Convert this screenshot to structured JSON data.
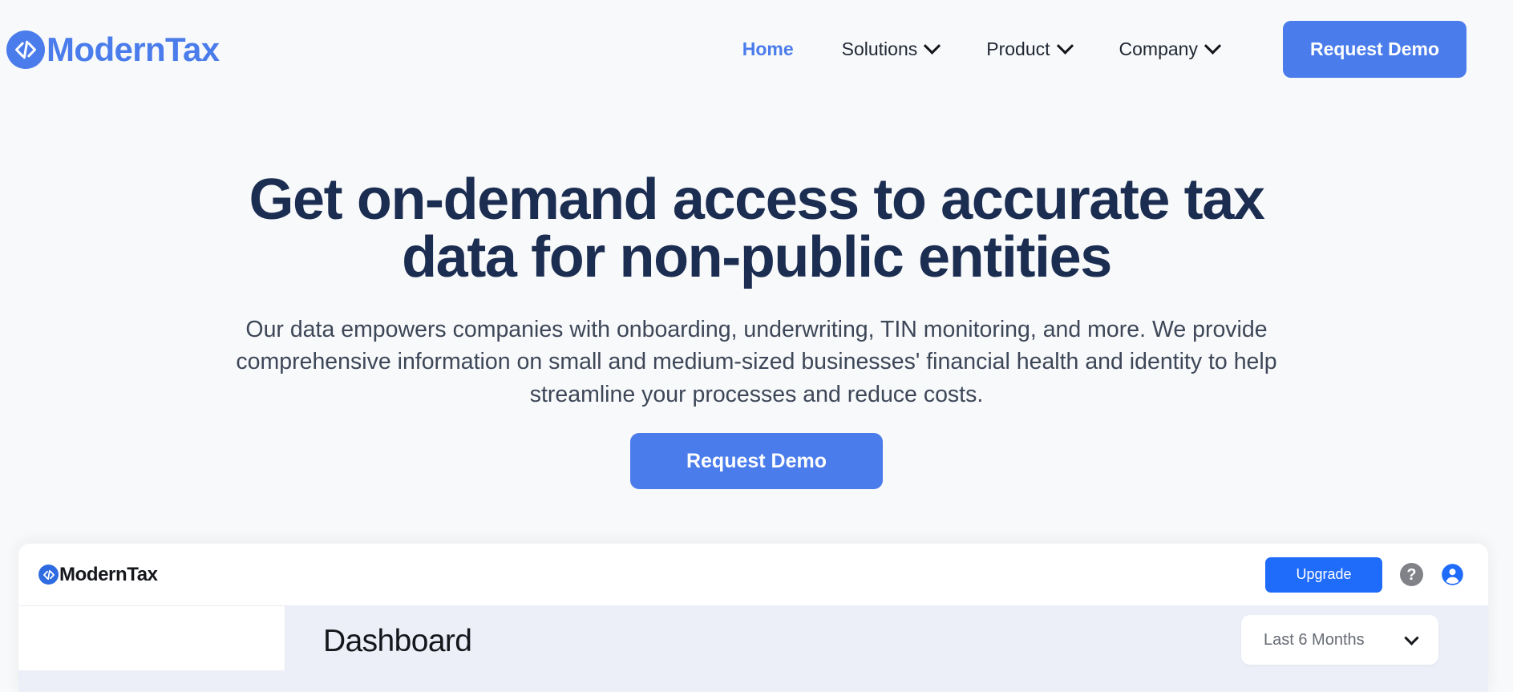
{
  "brand": {
    "name": "ModernTax",
    "logo_icon": "code-brackets-icon",
    "color": "#4a7ceb"
  },
  "nav": {
    "items": [
      {
        "label": "Home",
        "active": true,
        "has_dropdown": false
      },
      {
        "label": "Solutions",
        "active": false,
        "has_dropdown": true
      },
      {
        "label": "Product",
        "active": false,
        "has_dropdown": true
      },
      {
        "label": "Company",
        "active": false,
        "has_dropdown": true
      }
    ],
    "cta_label": "Request Demo"
  },
  "hero": {
    "title": "Get on-demand access to accurate tax data for non-public entities",
    "subtitle": "Our data empowers companies with onboarding, underwriting, TIN monitoring, and more. We provide comprehensive information on small and medium-sized businesses' financial health and identity to help streamline your processes and reduce costs.",
    "cta_label": "Request Demo"
  },
  "dashboard_preview": {
    "brand_name": "ModernTax",
    "upgrade_label": "Upgrade",
    "help_icon": "question-mark-icon",
    "help_glyph": "?",
    "account_icon": "account-circle-icon",
    "page_title": "Dashboard",
    "date_range": {
      "selected": "Last 6 Months",
      "options": [
        "Last 6 Months"
      ]
    }
  },
  "colors": {
    "page_background": "#f8f9fa",
    "accent_blue": "#4a7ceb",
    "upgrade_blue": "#1f6bfa",
    "heading_navy": "#1c2d52",
    "body_text": "#3d4758",
    "dash_content_bg": "#eceff8"
  }
}
